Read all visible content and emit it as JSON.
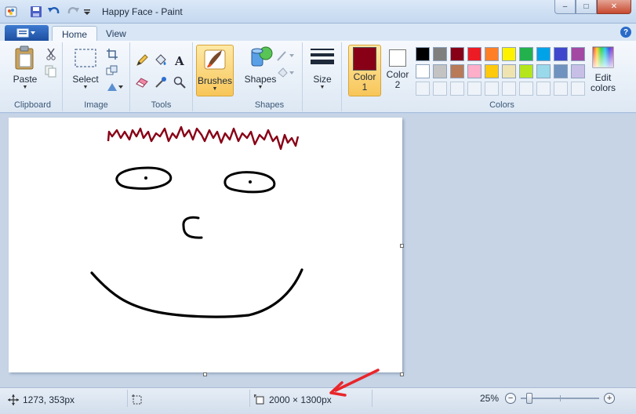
{
  "window": {
    "title": "Happy Face - Paint",
    "minimize": "–",
    "maximize": "□",
    "close": "✕"
  },
  "tabs": [
    {
      "label": "Home",
      "active": true
    },
    {
      "label": "View",
      "active": false
    }
  ],
  "help": "?",
  "ribbon": {
    "clipboard": {
      "label": "Clipboard",
      "paste": "Paste"
    },
    "image": {
      "label": "Image",
      "select": "Select"
    },
    "tools": {
      "label": "Tools"
    },
    "brushes": {
      "label": "Brushes"
    },
    "shapes": {
      "label": "Shapes",
      "button": "Shapes"
    },
    "size": {
      "label": "Size"
    },
    "color1": {
      "label": "Color",
      "number": "1",
      "color": "#880015"
    },
    "color2": {
      "label": "Color",
      "number": "2",
      "color": "#ffffff"
    },
    "colors": {
      "label": "Colors"
    },
    "edit_colors": {
      "line1": "Edit",
      "line2": "colors"
    }
  },
  "palette": {
    "row1": [
      "#000000",
      "#7f7f7f",
      "#880015",
      "#ed1c24",
      "#ff7f27",
      "#fff200",
      "#22b14c",
      "#00a2e8",
      "#3f48cc",
      "#a349a4"
    ],
    "row2": [
      "#ffffff",
      "#c3c3c3",
      "#b97a57",
      "#ffaec9",
      "#ffc90e",
      "#efe4b0",
      "#b5e61d",
      "#99d9ea",
      "#7092be",
      "#c8bfe7"
    ]
  },
  "status": {
    "cursor": "1273, 353px",
    "image_size": "2000 × 1300px",
    "zoom": "25%",
    "zoom_level": 0.25
  },
  "drawing": {
    "hair_color": "#880015",
    "line_color": "#000000",
    "annotation_color": "#e8262b"
  }
}
